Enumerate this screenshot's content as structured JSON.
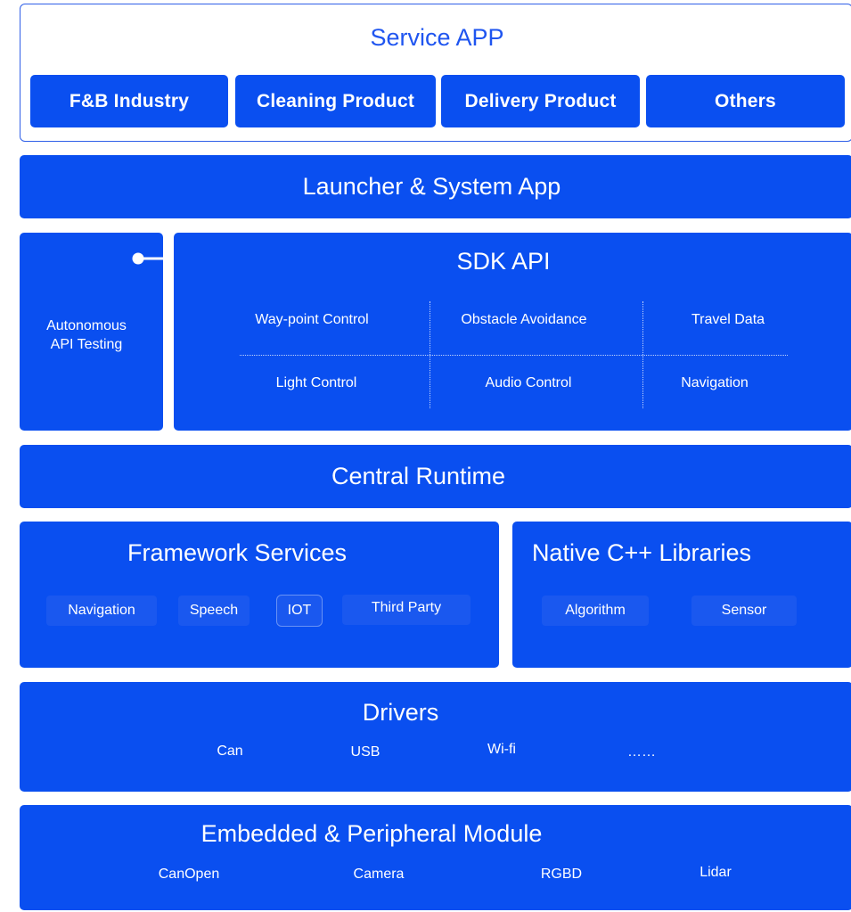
{
  "service_app": {
    "title": "Service APP",
    "items": [
      "F&B Industry",
      "Cleaning Product",
      "Delivery Product",
      "Others"
    ]
  },
  "launcher": {
    "title": "Launcher & System App"
  },
  "autonomous": {
    "line1": "Autonomous",
    "line2": "API Testing"
  },
  "sdk_api": {
    "title": "SDK API",
    "row1": [
      "Way-point Control",
      "Obstacle Avoidance",
      "Travel Data"
    ],
    "row2": [
      "Light Control",
      "Audio Control",
      "Navigation"
    ]
  },
  "central_runtime": {
    "title": "Central Runtime"
  },
  "framework_services": {
    "title": "Framework Services",
    "items": [
      "Navigation",
      "Speech",
      "IOT",
      "Third Party"
    ]
  },
  "native_libraries": {
    "title": "Native C++ Libraries",
    "items": [
      "Algorithm",
      "Sensor"
    ]
  },
  "drivers": {
    "title": "Drivers",
    "items": [
      "Can",
      "USB",
      "Wi-fi",
      "……"
    ]
  },
  "embedded": {
    "title": "Embedded & Peripheral Module",
    "items": [
      "CanOpen",
      "Camera",
      "RGBD",
      "Lidar"
    ]
  },
  "colors": {
    "primary_blue": "#0a4ff0",
    "outline_blue": "#2f5fe8",
    "chip_blue": "#1a58ef"
  }
}
